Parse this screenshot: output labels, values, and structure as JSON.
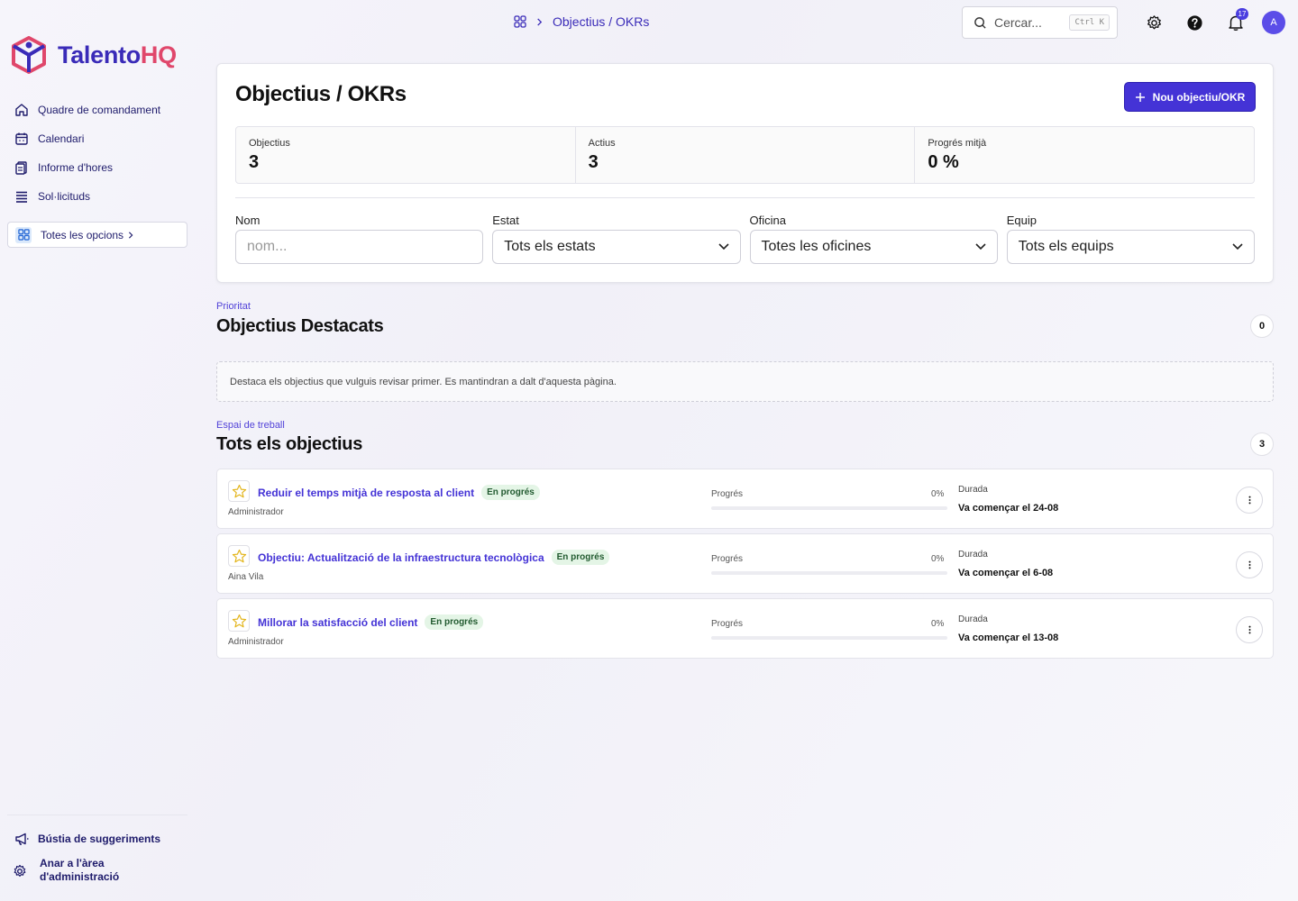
{
  "brand": {
    "name_part1": "Talento",
    "name_part2": "HQ",
    "color_primary": "#3a2bb8",
    "color_accent": "#e0476b"
  },
  "sidebar": {
    "items": [
      {
        "label": "Quadre de comandament",
        "icon": "home-icon"
      },
      {
        "label": "Calendari",
        "icon": "calendar-icon"
      },
      {
        "label": "Informe d'hores",
        "icon": "report-icon"
      },
      {
        "label": "Sol·licituds",
        "icon": "list-icon"
      }
    ],
    "all_options": "Totes les opcions",
    "bottom": {
      "suggestions": "Bústia de suggeriments",
      "admin_line1": "Anar a l'àrea",
      "admin_line2": "d'administració"
    }
  },
  "topbar": {
    "breadcrumb": "Objectius / OKRs",
    "search_placeholder": "Cercar...",
    "search_shortcut": "Ctrl K",
    "notifications_count": "17",
    "avatar_initial": "A"
  },
  "header": {
    "title": "Objectius / OKRs",
    "new_button": "Nou objectiu/OKR"
  },
  "stats": [
    {
      "label": "Objectius",
      "value": "3"
    },
    {
      "label": "Actius",
      "value": "3"
    },
    {
      "label": "Progrés mitjà",
      "value": "0 %"
    }
  ],
  "filters": {
    "name": {
      "label": "Nom",
      "placeholder": "nom..."
    },
    "status": {
      "label": "Estat",
      "value": "Tots els estats"
    },
    "office": {
      "label": "Oficina",
      "value": "Totes les oficines"
    },
    "team": {
      "label": "Equip",
      "value": "Tots els equips"
    }
  },
  "featured": {
    "kicker": "Prioritat",
    "title": "Objectius Destacats",
    "count": "0",
    "empty_text": "Destaca els objectius que vulguis revisar primer. Es mantindran a dalt d'aquesta pàgina."
  },
  "all": {
    "kicker": "Espai de treball",
    "title": "Tots els objectius",
    "count": "3",
    "progress_label": "Progrés",
    "duration_label": "Durada",
    "items": [
      {
        "title": "Reduir el temps mitjà de resposta al client",
        "status": "En progrés",
        "owner": "Administrador",
        "progress": "0%",
        "progress_fraction": 0,
        "duration": "Va començar el 24-08"
      },
      {
        "title": "Objectiu: Actualització de la infraestructura tecnològica",
        "status": "En progrés",
        "owner": "Aina Vila",
        "progress": "0%",
        "progress_fraction": 0,
        "duration": "Va començar el 6-08"
      },
      {
        "title": "Millorar la satisfacció del client",
        "status": "En progrés",
        "owner": "Administrador",
        "progress": "0%",
        "progress_fraction": 0,
        "duration": "Va començar el 13-08"
      }
    ]
  }
}
